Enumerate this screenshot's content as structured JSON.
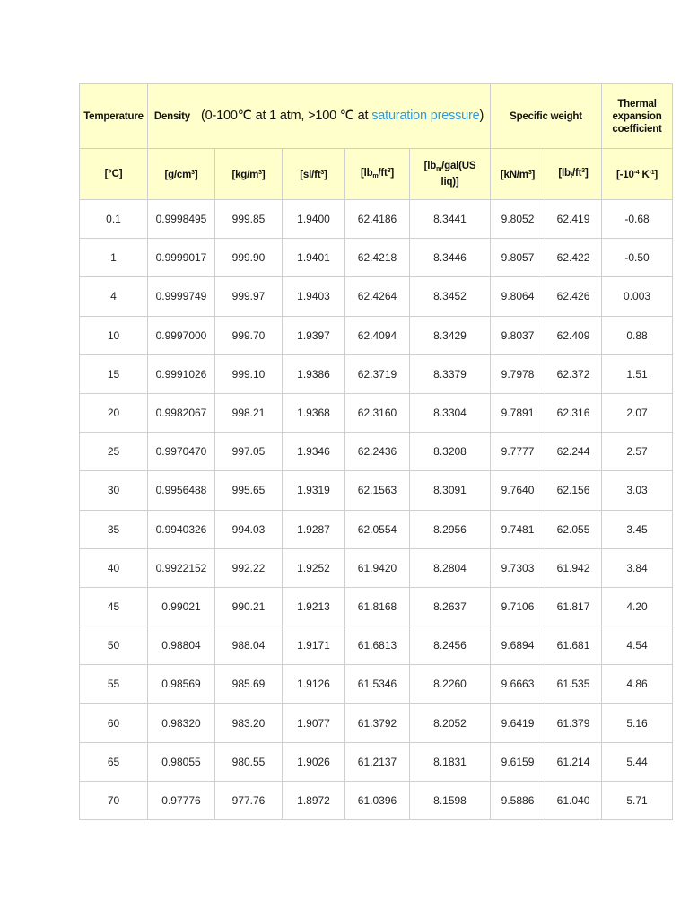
{
  "header": {
    "temperature": "Temperature",
    "density": "Density",
    "density_note_prefix": "(0-100℃ at 1 atm, >100 ℃ at ",
    "density_note_link": "saturation pressure",
    "density_note_suffix": ")",
    "specific_weight": "Specific weight",
    "thermal": "Thermal expansion coefficient"
  },
  "units": {
    "temp": "[°C]",
    "gcm": {
      "a": "[g/cm",
      "sup": "3",
      "b": "]"
    },
    "kgm": {
      "a": "[kg/m",
      "sup": "3",
      "b": "]"
    },
    "slft": {
      "a": "[sl/ft",
      "sup": "3",
      "b": "]"
    },
    "lbmft": {
      "a": "[lb",
      "sub": "m",
      "c": "/ft",
      "sup": "3",
      "b": "]"
    },
    "lbmgal": {
      "a": "[lb",
      "sub": "m",
      "c": "/gal(US liq)]"
    },
    "knm": {
      "a": "[kN/m",
      "sup": "3",
      "b": "]"
    },
    "lbfft": {
      "a": "[lb",
      "sub": "f",
      "c": "/ft",
      "sup": "3",
      "b": "]"
    },
    "coef": {
      "a": "[-10",
      "sup": "-4",
      "c": " K",
      "sup2": "-1",
      "b": "]"
    }
  },
  "rows": [
    [
      "0.1",
      "0.9998495",
      "999.85",
      "1.9400",
      "62.4186",
      "8.3441",
      "9.8052",
      "62.419",
      "-0.68"
    ],
    [
      "1",
      "0.9999017",
      "999.90",
      "1.9401",
      "62.4218",
      "8.3446",
      "9.8057",
      "62.422",
      "-0.50"
    ],
    [
      "4",
      "0.9999749",
      "999.97",
      "1.9403",
      "62.4264",
      "8.3452",
      "9.8064",
      "62.426",
      "0.003"
    ],
    [
      "10",
      "0.9997000",
      "999.70",
      "1.9397",
      "62.4094",
      "8.3429",
      "9.8037",
      "62.409",
      "0.88"
    ],
    [
      "15",
      "0.9991026",
      "999.10",
      "1.9386",
      "62.3719",
      "8.3379",
      "9.7978",
      "62.372",
      "1.51"
    ],
    [
      "20",
      "0.9982067",
      "998.21",
      "1.9368",
      "62.3160",
      "8.3304",
      "9.7891",
      "62.316",
      "2.07"
    ],
    [
      "25",
      "0.9970470",
      "997.05",
      "1.9346",
      "62.2436",
      "8.3208",
      "9.7777",
      "62.244",
      "2.57"
    ],
    [
      "30",
      "0.9956488",
      "995.65",
      "1.9319",
      "62.1563",
      "8.3091",
      "9.7640",
      "62.156",
      "3.03"
    ],
    [
      "35",
      "0.9940326",
      "994.03",
      "1.9287",
      "62.0554",
      "8.2956",
      "9.7481",
      "62.055",
      "3.45"
    ],
    [
      "40",
      "0.9922152",
      "992.22",
      "1.9252",
      "61.9420",
      "8.2804",
      "9.7303",
      "61.942",
      "3.84"
    ],
    [
      "45",
      "0.99021",
      "990.21",
      "1.9213",
      "61.8168",
      "8.2637",
      "9.7106",
      "61.817",
      "4.20"
    ],
    [
      "50",
      "0.98804",
      "988.04",
      "1.9171",
      "61.6813",
      "8.2456",
      "9.6894",
      "61.681",
      "4.54"
    ],
    [
      "55",
      "0.98569",
      "985.69",
      "1.9126",
      "61.5346",
      "8.2260",
      "9.6663",
      "61.535",
      "4.86"
    ],
    [
      "60",
      "0.98320",
      "983.20",
      "1.9077",
      "61.3792",
      "8.2052",
      "9.6419",
      "61.379",
      "5.16"
    ],
    [
      "65",
      "0.98055",
      "980.55",
      "1.9026",
      "61.2137",
      "8.1831",
      "9.6159",
      "61.214",
      "5.44"
    ],
    [
      "70",
      "0.97776",
      "977.76",
      "1.8972",
      "61.0396",
      "8.1598",
      "9.5886",
      "61.040",
      "5.71"
    ]
  ]
}
